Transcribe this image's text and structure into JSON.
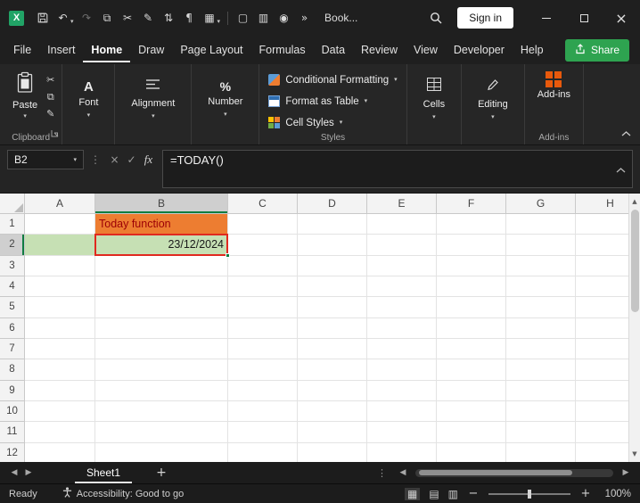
{
  "titlebar": {
    "document_title": "Book...",
    "sign_in_label": "Sign in"
  },
  "menubar": {
    "tabs": [
      "File",
      "Insert",
      "Home",
      "Draw",
      "Page Layout",
      "Formulas",
      "Data",
      "Review",
      "View",
      "Developer",
      "Help"
    ],
    "active_tab": "Home",
    "share_label": "Share"
  },
  "ribbon": {
    "paste_label": "Paste",
    "clipboard_group_label": "Clipboard",
    "font_label": "Font",
    "alignment_label": "Alignment",
    "number_label": "Number",
    "conditional_formatting_label": "Conditional Formatting",
    "format_as_table_label": "Format as Table",
    "cell_styles_label": "Cell Styles",
    "styles_group_label": "Styles",
    "cells_label": "Cells",
    "editing_label": "Editing",
    "addins_label": "Add-ins",
    "addins_group_label": "Add-ins"
  },
  "formula_bar": {
    "name_box_value": "B2",
    "formula_value": "=TODAY()"
  },
  "grid": {
    "columns": [
      "A",
      "B",
      "C",
      "D",
      "E",
      "F",
      "G",
      "H"
    ],
    "rows": [
      1,
      2,
      3,
      4,
      5,
      6,
      7,
      8,
      9,
      10,
      11,
      12
    ],
    "selected_column": "B",
    "selected_row": 2,
    "cells": {
      "B1": {
        "text": "Today function",
        "fill": "#ED7D31",
        "color": "#9C0006",
        "align": "left"
      },
      "A2": {
        "fill": "#C6E0B4"
      },
      "B2": {
        "text": "23/12/2024",
        "fill": "#C6E0B4",
        "color": "#1a1a1a",
        "align": "right",
        "selected": true
      }
    },
    "colors": {
      "selection_border": "#E0291F",
      "fill_handle": "#107C41"
    }
  },
  "sheetbar": {
    "tabs": [
      "Sheet1"
    ],
    "active_tab": "Sheet1"
  },
  "statusbar": {
    "mode_label": "Ready",
    "accessibility_label": "Accessibility: Good to go",
    "zoom_label": "100%"
  },
  "icons": {
    "logo_letter": "X",
    "undo": "↶",
    "redo": "↷",
    "copy": "⧉",
    "cut": "✂",
    "format_painter": "✎",
    "sort": "⇅",
    "paragraph": "¶",
    "borders": "▦",
    "page": "▢",
    "freeze": "▥",
    "camera": "◉",
    "more": "»",
    "dropdown": "▾",
    "dots": "⋮",
    "cancel": "×",
    "enter": "✓",
    "fx": "fx",
    "font_letter": "A",
    "percent": "%",
    "left": "◀",
    "right": "▶",
    "up": "▲",
    "down": "▼",
    "plus": "+",
    "minus": "−",
    "close": "×",
    "view_normal": "▦",
    "view_layout": "▤",
    "view_break": "▥"
  }
}
